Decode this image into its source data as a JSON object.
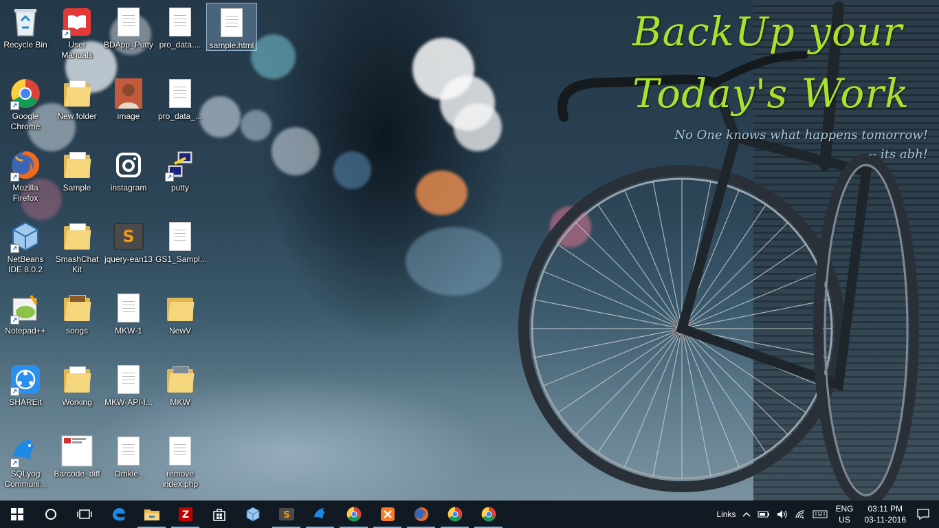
{
  "wallpaper": {
    "headline_1": "BackUp your",
    "headline_2": "Today's Work",
    "subline_1": "No One knows what happens tomorrow!",
    "subline_2": "-- its abh!",
    "accent_color": "#a9e22b"
  },
  "desktop_icons": [
    {
      "label": "Recycle Bin",
      "icon": "recycle-bin-icon"
    },
    {
      "label": "User Manuals",
      "icon": "book-icon"
    },
    {
      "label": "BDApp_Putty",
      "icon": "document-icon"
    },
    {
      "label": "pro_data....",
      "icon": "document-icon"
    },
    {
      "label": "sample.html",
      "icon": "document-icon"
    },
    {
      "label": "Google Chrome",
      "icon": "chrome-icon"
    },
    {
      "label": "New folder",
      "icon": "folder-icon"
    },
    {
      "label": "image",
      "icon": "photo-icon"
    },
    {
      "label": "pro_data_...",
      "icon": "document-icon"
    },
    {
      "label": "Mozilla Firefox",
      "icon": "firefox-icon"
    },
    {
      "label": "Sample",
      "icon": "folder-icon"
    },
    {
      "label": "instagram",
      "icon": "instagram-icon"
    },
    {
      "label": "putty",
      "icon": "putty-icon"
    },
    {
      "label": "NetBeans IDE 8.0.2",
      "icon": "netbeans-icon"
    },
    {
      "label": "SmashChat Kit",
      "icon": "folder-icon"
    },
    {
      "label": "jquery-ean13",
      "icon": "sublime-icon"
    },
    {
      "label": "GS1_Sampl...",
      "icon": "document-icon"
    },
    {
      "label": "Notepad++",
      "icon": "notepadpp-icon"
    },
    {
      "label": "songs",
      "icon": "folder-icon"
    },
    {
      "label": "MKW-1",
      "icon": "document-icon"
    },
    {
      "label": "NewV",
      "icon": "folder-icon"
    },
    {
      "label": "SHAREit",
      "icon": "shareit-icon"
    },
    {
      "label": "Working",
      "icon": "folder-icon"
    },
    {
      "label": "MKW-API-I...",
      "icon": "document-icon"
    },
    {
      "label": "MKW",
      "icon": "folder-icon"
    },
    {
      "label": "SQLyog Communi...",
      "icon": "sqlyog-icon"
    },
    {
      "label": "Barcode_diff",
      "icon": "image-file-icon"
    },
    {
      "label": "Omkie_",
      "icon": "document-icon"
    },
    {
      "label": "remove index.php",
      "icon": "document-icon"
    }
  ],
  "taskbar": {
    "apps": [
      {
        "name": "start-button",
        "icon": "windows-logo-icon"
      },
      {
        "name": "cortana-button",
        "icon": "circle-icon"
      },
      {
        "name": "task-view-button",
        "icon": "task-view-icon"
      },
      {
        "name": "edge-button",
        "icon": "edge-icon"
      },
      {
        "name": "file-explorer-button",
        "icon": "folder-icon"
      },
      {
        "name": "filezilla-button",
        "icon": "filezilla-icon"
      },
      {
        "name": "store-button",
        "icon": "store-icon"
      },
      {
        "name": "netbeans-taskbar-button",
        "icon": "netbeans-icon"
      },
      {
        "name": "sublime-taskbar-button",
        "icon": "sublime-icon"
      },
      {
        "name": "sqlyog-taskbar-button",
        "icon": "sqlyog-icon"
      },
      {
        "name": "chrome-taskbar-button-1",
        "icon": "chrome-icon"
      },
      {
        "name": "xampp-taskbar-button",
        "icon": "xampp-icon"
      },
      {
        "name": "firefox-taskbar-button",
        "icon": "firefox-icon"
      },
      {
        "name": "chrome-taskbar-button-2",
        "icon": "chrome-icon"
      },
      {
        "name": "chrome-taskbar-button-3",
        "icon": "chrome-icon"
      }
    ],
    "tray": {
      "links_label": "Links",
      "language": "ENG",
      "region": "US",
      "time": "03:11 PM",
      "date": "03-11-2016"
    }
  }
}
